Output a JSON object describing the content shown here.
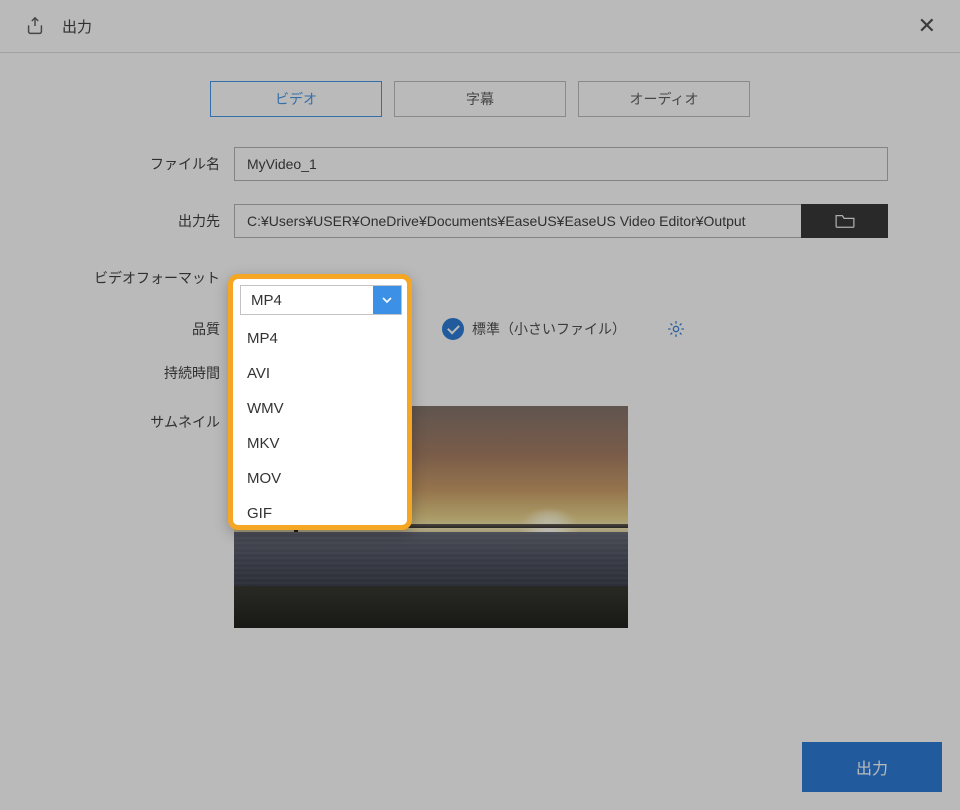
{
  "header": {
    "title": "出力"
  },
  "tabs": [
    {
      "label": "ビデオ",
      "active": true
    },
    {
      "label": "字幕",
      "active": false
    },
    {
      "label": "オーディオ",
      "active": false
    }
  ],
  "labels": {
    "filename": "ファイル名",
    "outputTo": "出力先",
    "videoFormat": "ビデオフォーマット",
    "quality": "品質",
    "duration": "持続時間",
    "thumbnail": "サムネイル"
  },
  "fields": {
    "filename": "MyVideo_1",
    "outputPath": "C:¥Users¥USER¥OneDrive¥Documents¥EaseUS¥EaseUS Video Editor¥Output"
  },
  "formatSelect": {
    "selected": "MP4",
    "options": [
      "MP4",
      "AVI",
      "WMV",
      "MKV",
      "MOV",
      "GIF"
    ]
  },
  "quality": {
    "standard_label": "標準（小さいファイル）"
  },
  "buttons": {
    "output": "出力"
  }
}
